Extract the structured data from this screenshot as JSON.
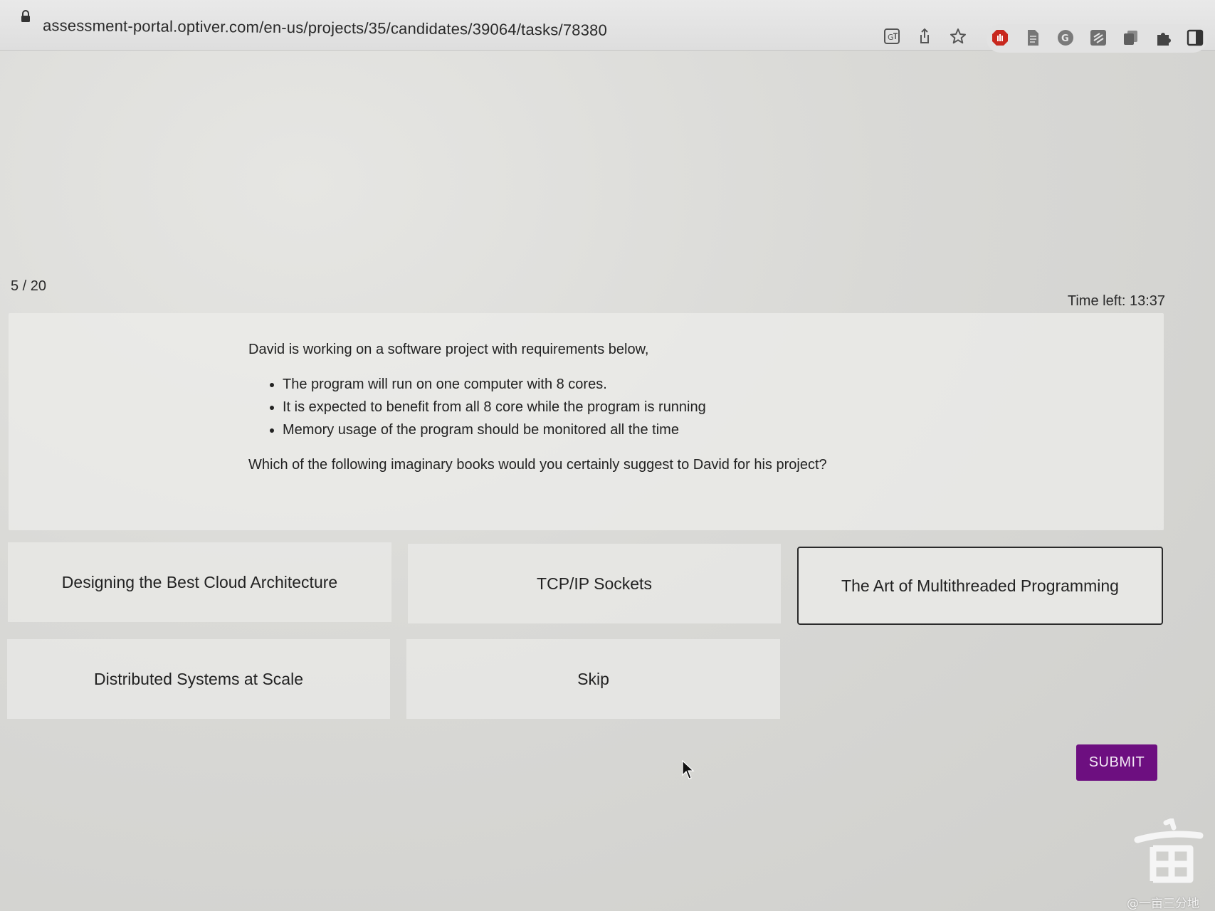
{
  "browser": {
    "url": "assessment-portal.optiver.com/en-us/projects/35/candidates/39064/tasks/78380",
    "toolbar_icons": [
      "translate-icon",
      "share-icon",
      "bookmark-star-icon"
    ],
    "extension_icons": [
      "adblock-extension-icon",
      "document-extension-icon",
      "grammarly-extension-icon",
      "notes-extension-icon",
      "copy-extension-icon",
      "extensions-puzzle-icon",
      "side-panel-icon"
    ]
  },
  "assessment": {
    "progress": "5 / 20",
    "time_left": "Time left: 13:37",
    "question": {
      "intro": "David is working on a software project with requirements below,",
      "requirements": [
        "The program will run on one computer with 8 cores.",
        "It is expected to benefit from all 8 core while the program is running",
        "Memory usage of the program should be monitored all the time"
      ],
      "prompt": "Which of the following imaginary books would you certainly suggest to David for his project?"
    },
    "options": [
      {
        "label": "Designing the Best Cloud Architecture",
        "selected": false
      },
      {
        "label": "TCP/IP Sockets",
        "selected": false
      },
      {
        "label": "The Art of Multithreaded Programming",
        "selected": true
      },
      {
        "label": "Distributed Systems at Scale",
        "selected": false
      },
      {
        "label": "Skip",
        "selected": false
      }
    ],
    "submit_label": "SUBMIT"
  },
  "watermark": {
    "text": "@一亩三分地",
    "seal_glyph": "亩"
  },
  "colors": {
    "submit": "#6d0f80",
    "adblock": "#c8281e",
    "selected_border": "#2a2a2a"
  }
}
